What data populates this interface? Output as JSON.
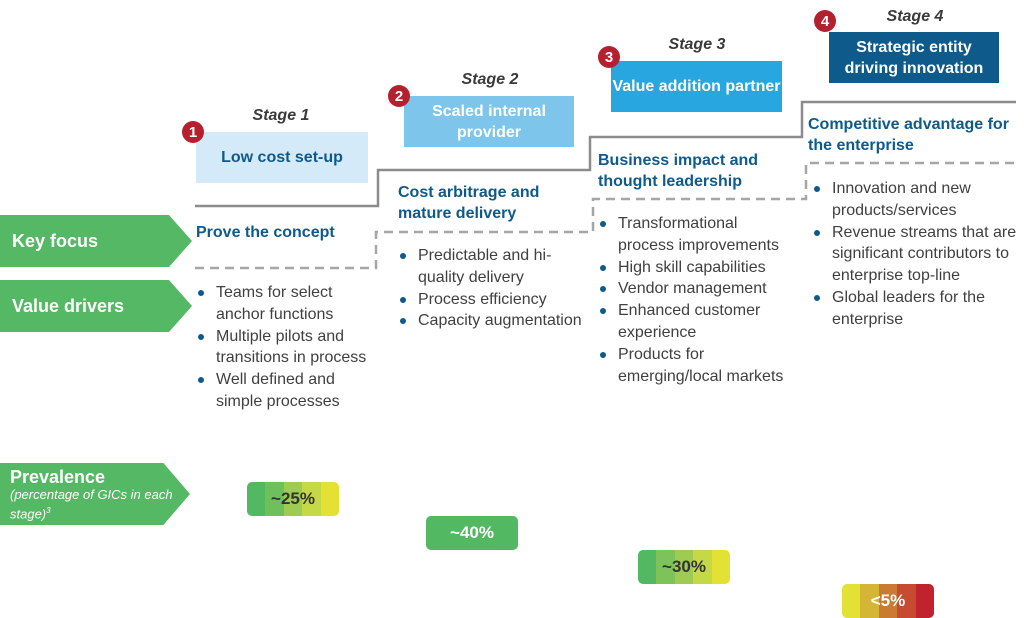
{
  "rows": {
    "key_focus": "Key focus",
    "value_drivers": "Value drivers",
    "prevalence_title": "Prevalence",
    "prevalence_sub": "(percentage of GICs in each stage)",
    "prevalence_footnote": "3"
  },
  "stages": [
    {
      "number": "1",
      "label": "Stage 1",
      "name": "Low cost set-up",
      "box_color": "#d5eaf8",
      "text_color": "#0e5a8a",
      "focus": "Prove the concept",
      "drivers": [
        "Teams for select anchor functions",
        "Multiple pilots and transitions in process",
        "Well defined and simple processes"
      ],
      "prevalence": "~25%",
      "prevalence_text_color": "#333333",
      "prevalence_colors": [
        "#53b862",
        "#6fbf5c",
        "#9ecb52",
        "#c5d946",
        "#e2e134"
      ]
    },
    {
      "number": "2",
      "label": "Stage 2",
      "name": "Scaled internal provider",
      "box_color": "#7dc5ea",
      "text_color": "#ffffff",
      "focus": "Cost arbitrage and mature delivery",
      "drivers": [
        "Predictable and hi-quality delivery",
        "Process efficiency",
        "Capacity augmentation"
      ],
      "prevalence": "~40%",
      "prevalence_text_color": "#ffffff",
      "prevalence_colors": [
        "#53b862"
      ]
    },
    {
      "number": "3",
      "label": "Stage 3",
      "name": "Value addition partner",
      "box_color": "#27a6df",
      "text_color": "#ffffff",
      "focus": "Business impact and thought leadership",
      "drivers": [
        "Transformational process improvements",
        "High skill capabilities",
        "Vendor management",
        "Enhanced customer experience",
        "Products for emerging/local markets"
      ],
      "prevalence": "~30%",
      "prevalence_text_color": "#333333",
      "prevalence_colors": [
        "#53b862",
        "#7ec35a",
        "#a0cb52",
        "#c5d946",
        "#e2e134"
      ]
    },
    {
      "number": "4",
      "label": "Stage 4",
      "name": "Strategic entity driving innovation",
      "box_color": "#0e5a8a",
      "text_color": "#ffffff",
      "focus": "Competitive advantage for the enterprise",
      "drivers": [
        "Innovation and new products/services",
        "Revenue streams that are significant contributors to enterprise top-line",
        "Global leaders for the enterprise"
      ],
      "prevalence": "<5%",
      "prevalence_text_color": "#ffffff",
      "prevalence_colors": [
        "#e2e134",
        "#d4b535",
        "#cb7a31",
        "#c64b30",
        "#c0222e"
      ]
    }
  ]
}
